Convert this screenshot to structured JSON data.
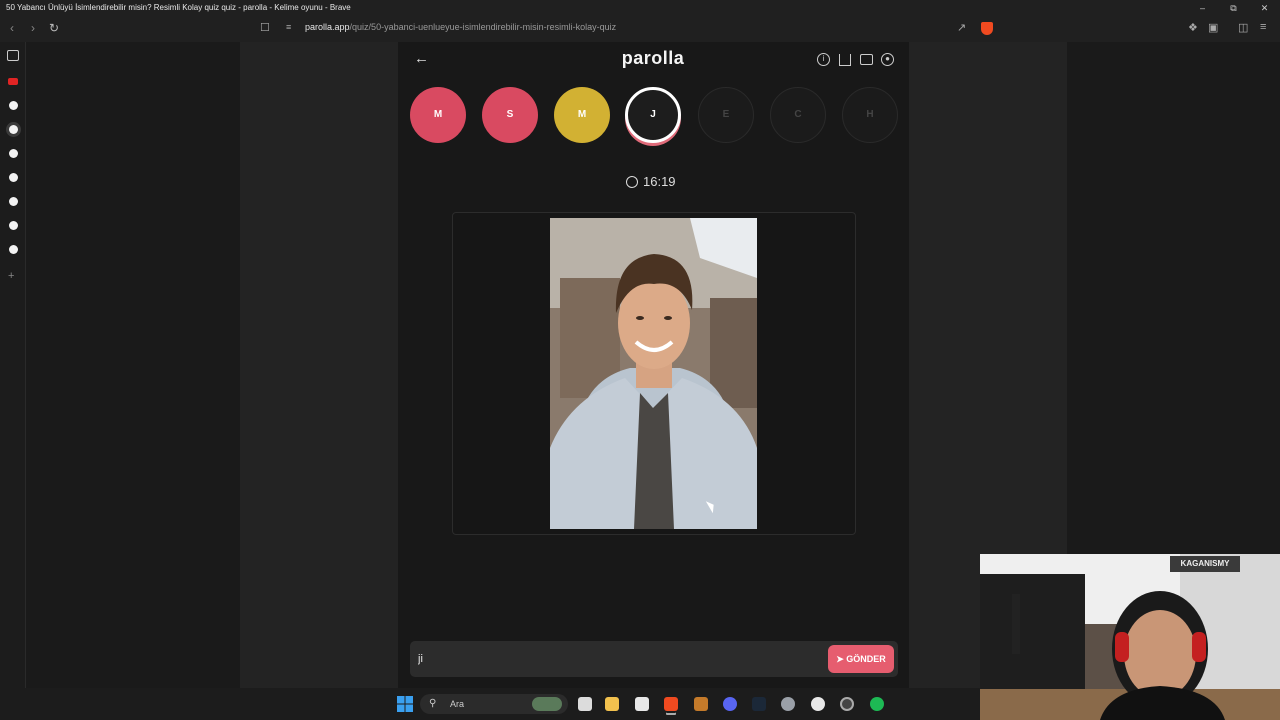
{
  "browser": {
    "window_title": "50 Yabancı Ünlüyü İsimlendirebilir misin? Resimli Kolay quiz quiz - parolla - Kelime oyunu - Brave",
    "url_domain": "parolla.app",
    "url_path": "/quiz/50-yabanci-uenlueyue-isimlendirebilir-misin-resimli-kolay-quiz"
  },
  "app": {
    "logo": "parolla",
    "header_icons": [
      "info-icon",
      "stats-icon",
      "chat-icon",
      "user-icon"
    ],
    "letters": [
      {
        "letter": "M",
        "state": "wrong",
        "color": "#d94a61"
      },
      {
        "letter": "S",
        "state": "wrong",
        "color": "#d94a61"
      },
      {
        "letter": "M",
        "state": "passed",
        "color": "#d2b133"
      },
      {
        "letter": "J",
        "state": "active",
        "color": "#ffffff"
      },
      {
        "letter": "E",
        "state": "empty"
      },
      {
        "letter": "C",
        "state": "empty"
      },
      {
        "letter": "H",
        "state": "empty"
      }
    ],
    "timer": "16:19",
    "answer_input_value": "ji",
    "send_label": "GÖNDER"
  },
  "taskbar": {
    "search_label": "Ara"
  },
  "webcam_overlay_text": "KAGANISMY"
}
